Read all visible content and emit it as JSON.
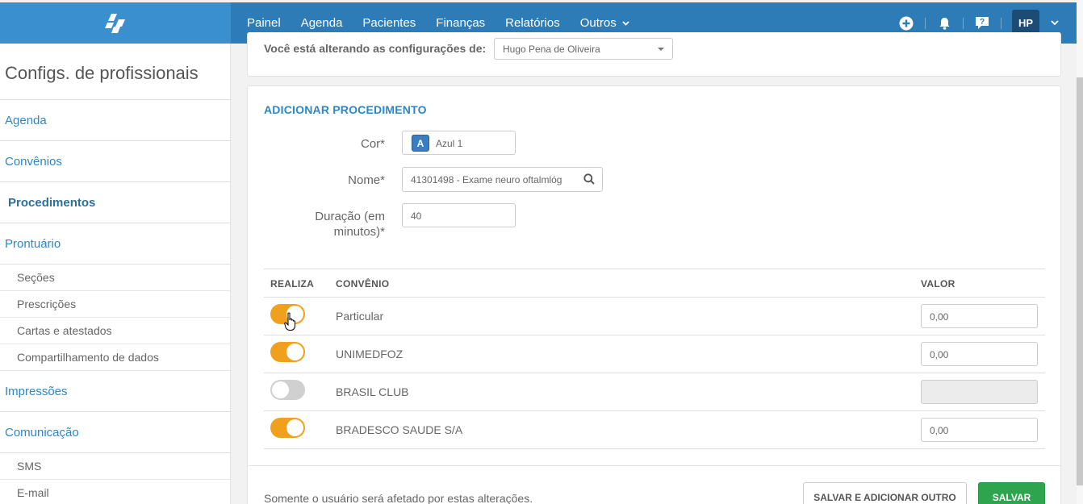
{
  "nav": {
    "items": [
      "Painel",
      "Agenda",
      "Pacientes",
      "Finanças",
      "Relatórios",
      "Outros"
    ]
  },
  "user": {
    "initials": "HP"
  },
  "sidebar": {
    "title": "Configs. de profissionais",
    "items": [
      {
        "label": "Agenda"
      },
      {
        "label": "Convênios"
      },
      {
        "label": "Procedimentos"
      },
      {
        "label": "Prontuário"
      },
      {
        "label": "Seções"
      },
      {
        "label": "Prescrições"
      },
      {
        "label": "Cartas e atestados"
      },
      {
        "label": "Compartilhamento de dados"
      },
      {
        "label": "Impressões"
      },
      {
        "label": "Comunicação"
      },
      {
        "label": "SMS"
      },
      {
        "label": "E-mail"
      }
    ]
  },
  "config": {
    "label": "Você está alterando as configurações de:",
    "professional": "Hugo Pena de Oliveira"
  },
  "form": {
    "title": "ADICIONAR PROCEDIMENTO",
    "color_label": "Cor*",
    "color_letter": "A",
    "color_value": "Azul 1",
    "name_label": "Nome*",
    "name_value": "41301498 - Exame neuro oftalmlóg",
    "duration_label_line1": "Duração (em",
    "duration_label_line2": "minutos)*",
    "duration_value": "40"
  },
  "table": {
    "headers": [
      "REALIZA",
      "CONVÊNIO",
      "VALOR"
    ],
    "rows": [
      {
        "realiza": true,
        "convenio": "Particular",
        "valor": "0,00"
      },
      {
        "realiza": true,
        "convenio": "UNIMEDFOZ",
        "valor": "0,00"
      },
      {
        "realiza": false,
        "convenio": "BRASIL CLUB",
        "valor": ""
      },
      {
        "realiza": true,
        "convenio": "BRADESCO SAUDE S/A",
        "valor": "0,00"
      }
    ]
  },
  "footer": {
    "note": "Somente o usuário será afetado por estas alterações.",
    "save_add_label": "SALVAR E ADICIONAR OUTRO",
    "save_label": "SALVAR"
  },
  "colors": {
    "primary": "#2d7cb7",
    "toggle_on": "#f0a01c",
    "save_green": "#2ea44f"
  }
}
